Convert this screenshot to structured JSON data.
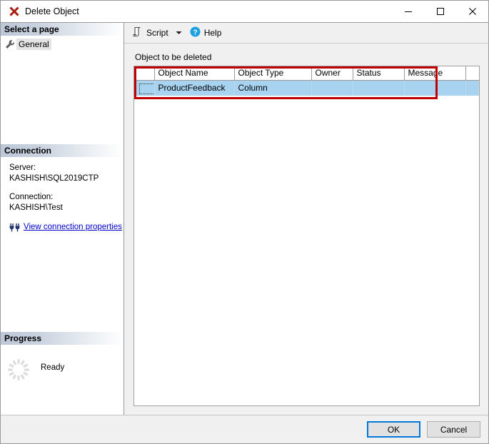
{
  "window": {
    "title": "Delete Object",
    "icon": "delete-x-icon",
    "controls": {
      "minimize": "—",
      "maximize": "□",
      "close": "✕"
    }
  },
  "sidebar": {
    "select_page_header": "Select a page",
    "pages": [
      {
        "label": "General",
        "icon": "wrench-icon",
        "selected": true
      }
    ],
    "connection": {
      "header": "Connection",
      "server_label": "Server:",
      "server_value": "KASHISH\\SQL2019CTP",
      "connection_label": "Connection:",
      "connection_value": "KASHISH\\Test",
      "properties_link": "View connection properties",
      "properties_icon": "connection-plug-icon"
    },
    "progress": {
      "header": "Progress",
      "status": "Ready",
      "icon": "spinner-icon"
    }
  },
  "toolbar": {
    "script_label": "Script",
    "script_icon": "script-icon",
    "script_caret": "▾",
    "help_label": "Help",
    "help_icon": "help-question-icon"
  },
  "main": {
    "grid_caption": "Object to be deleted",
    "columns": [
      "Object Name",
      "Object Type",
      "Owner",
      "Status",
      "Message"
    ],
    "rows": [
      {
        "object_name": "ProductFeedback",
        "object_type": "Column",
        "owner": "",
        "status": "",
        "message": "",
        "selected": true
      }
    ],
    "annotation": {
      "type": "highlight-rectangle",
      "color": "#c00000"
    }
  },
  "footer": {
    "ok_label": "OK",
    "cancel_label": "Cancel"
  },
  "colors": {
    "selection_blue": "#a8d3f0",
    "accent_blue": "#0078d7",
    "annotation_red": "#c00000",
    "link_blue": "#0000cd",
    "title_icon_red": "#a81a12"
  }
}
